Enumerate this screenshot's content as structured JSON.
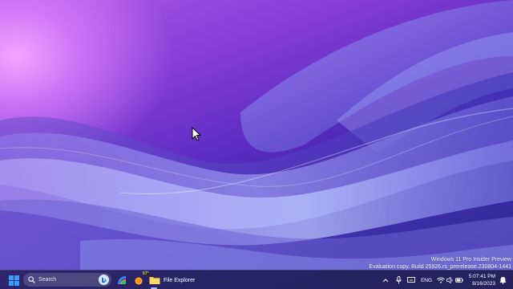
{
  "watermark": {
    "line1": "Windows 11 Pro Insider Preview",
    "line2": "Evaluation copy. Build 25926.rs_prerelease.230804-1441"
  },
  "taskbar": {
    "start_icon": "windows-logo-icon",
    "search_placeholder": "Search",
    "search_icon": "search-icon",
    "bing_icon": "bing-icon",
    "apps": [
      {
        "name": "bing-news-icon"
      },
      {
        "name": "weather-icon",
        "badge": "67°"
      },
      {
        "name": "folder-icon",
        "label": "File Explorer"
      }
    ],
    "tray": {
      "overflow_icon": "chevron-up-icon",
      "mic_icon": "microphone-icon",
      "display_icon": "display-icon",
      "language": "ENG",
      "wifi_icon": "wifi-icon",
      "volume_icon": "volume-icon",
      "battery_icon": "battery-icon",
      "time": "5:07:41 PM",
      "date": "8/16/2023",
      "notification_icon": "bell-icon"
    }
  },
  "colors": {
    "taskbar_bg": "#28265c",
    "accent": "#bbb6ff",
    "windows_blue": "#3b9cff",
    "folder_yellow": "#f5c542"
  }
}
